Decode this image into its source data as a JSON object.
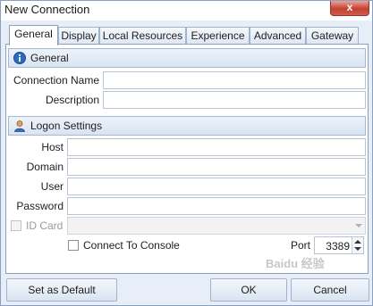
{
  "window": {
    "title": "New Connection",
    "close_glyph": "x"
  },
  "tabs": [
    {
      "label": "General"
    },
    {
      "label": "Display"
    },
    {
      "label": "Local Resources"
    },
    {
      "label": "Experience"
    },
    {
      "label": "Advanced"
    },
    {
      "label": "Gateway"
    }
  ],
  "general": {
    "title": "General",
    "connection_name_label": "Connection Name",
    "connection_name_value": "",
    "description_label": "Description",
    "description_value": ""
  },
  "logon": {
    "title": "Logon Settings",
    "host_label": "Host",
    "host_value": "",
    "domain_label": "Domain",
    "domain_value": "",
    "user_label": "User",
    "user_value": "",
    "password_label": "Password",
    "password_value": "",
    "id_card_label": "ID Card",
    "id_card_value": "",
    "id_card_checked": false,
    "connect_console_label": "Connect To Console",
    "connect_console_checked": false,
    "port_label": "Port",
    "port_value": "3389"
  },
  "footer": {
    "set_default_label": "Set as Default",
    "ok_label": "OK",
    "cancel_label": "Cancel"
  },
  "watermark": {
    "text": "Baidu 经验"
  },
  "icons": {
    "general_icon": "info-icon",
    "logon_icon": "user-icon"
  },
  "colors": {
    "accent": "#1e5fa8",
    "header_bg": "#d8e4f2",
    "window_bg": "#e7eef7"
  }
}
